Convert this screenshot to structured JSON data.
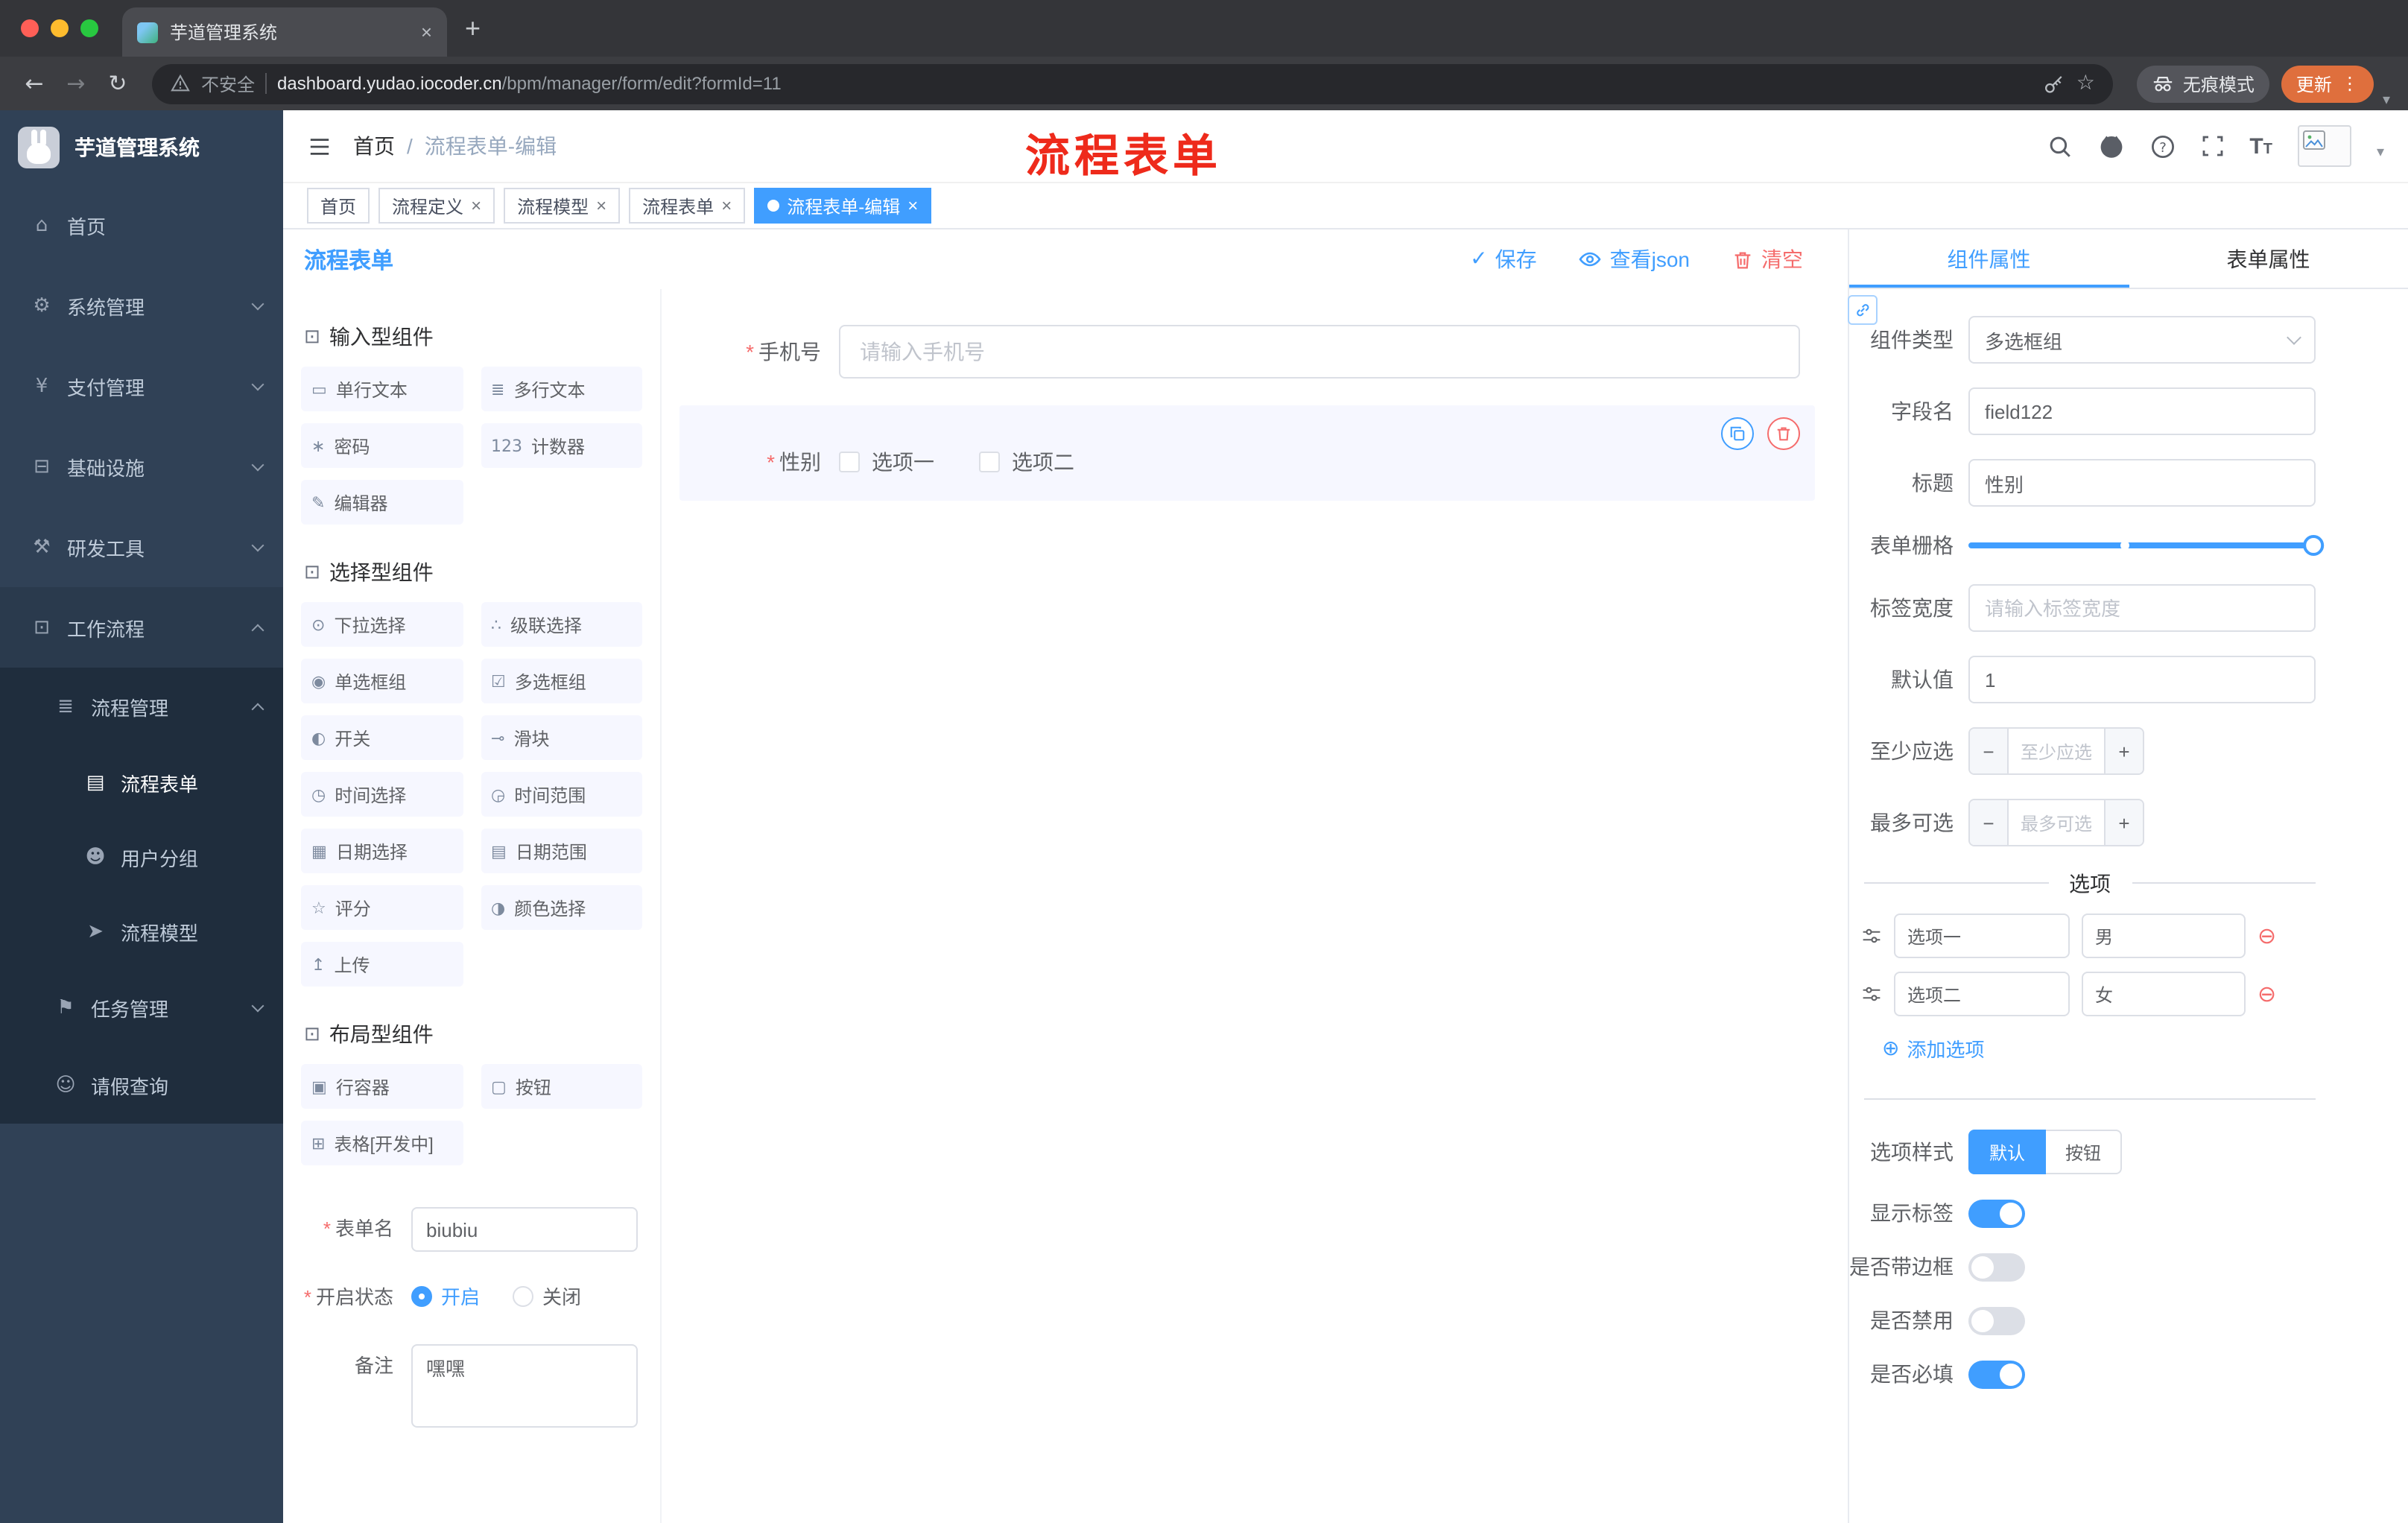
{
  "ui": {
    "close": "×",
    "new_tab": "+",
    "more": "⋮",
    "back": "←",
    "forward": "→",
    "reload": "↻",
    "caret": "▾",
    "minus": "−",
    "plus": "+",
    "add_icon": "⊕",
    "remove_icon": "⊖",
    "check": "✓",
    "t_big": "T",
    "t_small": "T"
  },
  "browser": {
    "tab_title": "芋道管理系统",
    "security_label": "不安全",
    "url_domain": "dashboard.yudao.iocoder.cn",
    "url_path": "/bpm/manager/form/edit?formId=11",
    "incognito_label": "无痕模式",
    "update_label": "更新"
  },
  "sidebar": {
    "logo_title": "芋道管理系统",
    "menu": [
      {
        "label": "首页",
        "glyph": "⌂"
      },
      {
        "label": "系统管理",
        "glyph": "⚙"
      },
      {
        "label": "支付管理",
        "glyph": "¥"
      },
      {
        "label": "基础设施",
        "glyph": "⊟"
      },
      {
        "label": "研发工具",
        "glyph": "⚒"
      },
      {
        "label": "工作流程",
        "glyph": "⊡"
      },
      {
        "label": "流程管理",
        "glyph": "≣"
      },
      {
        "label": "流程表单",
        "glyph": "▤"
      },
      {
        "label": "用户分组",
        "glyph": "☻"
      },
      {
        "label": "流程模型",
        "glyph": "➤"
      },
      {
        "label": "任务管理",
        "glyph": "⚑"
      },
      {
        "label": "请假查询",
        "glyph": "☺"
      }
    ]
  },
  "header": {
    "breadcrumb": {
      "home": "首页",
      "sep": "/",
      "current": "流程表单-编辑"
    },
    "annotation": "流程表单"
  },
  "tags": [
    {
      "label": "首页"
    },
    {
      "label": "流程定义"
    },
    {
      "label": "流程模型"
    },
    {
      "label": "流程表单"
    },
    {
      "label": "流程表单-编辑"
    }
  ],
  "designer": {
    "title": "流程表单",
    "actions": {
      "save": "保存",
      "view_json": "查看json",
      "clear": "清空"
    },
    "groups": [
      {
        "title": "输入型组件",
        "items": [
          {
            "label": "单行文本",
            "glyph": "▭"
          },
          {
            "label": "多行文本",
            "glyph": "≣"
          },
          {
            "label": "密码",
            "glyph": "∗"
          },
          {
            "label": "计数器",
            "glyph": "123"
          },
          {
            "label": "编辑器",
            "glyph": "✎"
          }
        ]
      },
      {
        "title": "选择型组件",
        "items": [
          {
            "label": "下拉选择",
            "glyph": "⊙"
          },
          {
            "label": "级联选择",
            "glyph": "∴"
          },
          {
            "label": "单选框组",
            "glyph": "◉"
          },
          {
            "label": "多选框组",
            "glyph": "☑"
          },
          {
            "label": "开关",
            "glyph": "◐"
          },
          {
            "label": "滑块",
            "glyph": "⊸"
          },
          {
            "label": "时间选择",
            "glyph": "◷"
          },
          {
            "label": "时间范围",
            "glyph": "◶"
          },
          {
            "label": "日期选择",
            "glyph": "▦"
          },
          {
            "label": "日期范围",
            "glyph": "▤"
          },
          {
            "label": "评分",
            "glyph": "☆"
          },
          {
            "label": "颜色选择",
            "glyph": "◑"
          },
          {
            "label": "上传",
            "glyph": "↥"
          }
        ]
      },
      {
        "title": "布局型组件",
        "items": [
          {
            "label": "行容器",
            "glyph": "▣"
          },
          {
            "label": "按钮",
            "glyph": "▢"
          },
          {
            "label": "表格[开发中]",
            "glyph": "⊞"
          }
        ]
      }
    ],
    "meta": {
      "name_label": "表单名",
      "name_value": "biubiu",
      "status_label": "开启状态",
      "status_on": "开启",
      "status_off": "关闭",
      "remark_label": "备注",
      "remark_value": "嘿嘿"
    },
    "canvas": {
      "phone_label": "手机号",
      "phone_placeholder": "请输入手机号",
      "gender_label": "性别",
      "gender_opt1": "选项一",
      "gender_opt2": "选项二"
    }
  },
  "props": {
    "tabs": {
      "component": "组件属性",
      "form": "表单属性"
    },
    "component_type_label": "组件类型",
    "component_type_value": "多选框组",
    "field_name_label": "字段名",
    "field_name_value": "field122",
    "title_label": "标题",
    "title_value": "性别",
    "grid_label": "表单栅格",
    "label_width_label": "标签宽度",
    "label_width_placeholder": "请输入标签宽度",
    "default_label": "默认值",
    "default_value": "1",
    "min_label": "至少应选",
    "min_placeholder": "至少应选",
    "max_label": "最多可选",
    "max_placeholder": "最多可选",
    "options_divider": "选项",
    "options": [
      {
        "name": "选项一",
        "value": "男"
      },
      {
        "name": "选项二",
        "value": "女"
      }
    ],
    "add_option": "添加选项",
    "style_label": "选项样式",
    "style_default": "默认",
    "style_button": "按钮",
    "show_label_label": "显示标签",
    "border_label": "是否带边框",
    "disabled_label": "是否禁用",
    "required_label": "是否必填"
  },
  "colors": {
    "primary": "#409EFF",
    "danger": "#F56C6C",
    "sidebar": "#304156",
    "sidebar_sub": "#1F2D3D",
    "annotation": "#EE2A1B",
    "update_pill": "#DF6F3D"
  }
}
